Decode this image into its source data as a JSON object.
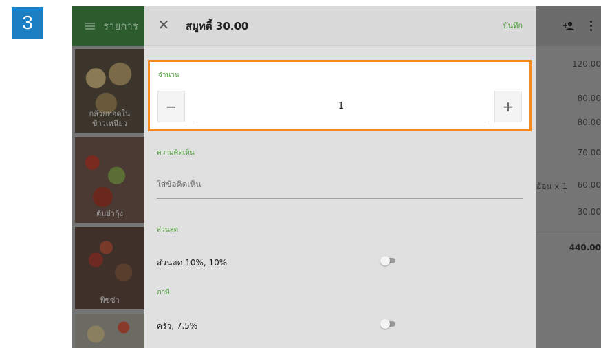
{
  "step_badge": "3",
  "left_panel": {
    "header_title": "รายการ",
    "products": [
      {
        "label_line1": "กล้วยทอดใน",
        "label_line2": "ข้าวเหนียว"
      },
      {
        "label": "ต้มยำกุ้ง"
      },
      {
        "label": "พิซซ่า"
      },
      {
        "label": ""
      }
    ]
  },
  "dialog": {
    "title": "สมูทตี้ 30.00",
    "save_label": "บันทึก",
    "quantity": {
      "label": "จำนวน",
      "minus": "−",
      "value": "1",
      "plus": "+"
    },
    "comment": {
      "label": "ความคิดเห็น",
      "placeholder": "ใส่ข้อคิดเห็น"
    },
    "discount": {
      "label": "ส่วนลด",
      "option_text": "ส่วนลด 10%, 10%",
      "enabled": false
    },
    "tax": {
      "label": "ภาษี",
      "option_text": "ครัว, 7.5%",
      "enabled": false
    }
  },
  "order_panel": {
    "item_text": "อ้อน x 1",
    "prices": [
      "120.00",
      "80.00",
      "80.00",
      "70.00",
      "60.00",
      "30.00"
    ],
    "total": "440.00"
  },
  "colors": {
    "badge": "#1c7fc3",
    "accent_green": "#4a9a36",
    "highlight_orange": "#f28a1e"
  },
  "icons": [
    "hamburger-icon",
    "close-icon",
    "add-person-icon",
    "kebab-menu-icon",
    "minus-icon",
    "plus-icon",
    "toggle-switch"
  ]
}
